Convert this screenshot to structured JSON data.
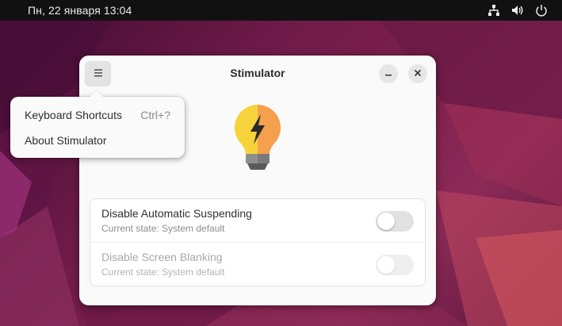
{
  "topbar": {
    "clock": "Пн, 22 января  13:04",
    "tray_icons": [
      "network-icon",
      "volume-icon",
      "power-icon"
    ]
  },
  "window": {
    "title": "Stimulator",
    "menu_icon": "hamburger-icon",
    "minimize_icon": "minimize-icon",
    "close_icon": "close-icon",
    "app_icon": "lightbulb-bolt-icon"
  },
  "popover": {
    "items": [
      {
        "label": "Keyboard Shortcuts",
        "accel": "Ctrl+?"
      },
      {
        "label": "About Stimulator"
      }
    ]
  },
  "settings": {
    "rows": [
      {
        "label": "Disable Automatic Suspending",
        "subtitle": "Current state: System default",
        "enabled": false,
        "sensitive": true
      },
      {
        "label": "Disable Screen Blanking",
        "subtitle": "Current state: System default",
        "enabled": false,
        "sensitive": false
      }
    ]
  },
  "colors": {
    "topbar": "#111111",
    "wallpaper": "#7c1f4c",
    "bulb_yellow": "#f6d33a",
    "bulb_orange": "#f5a04c"
  }
}
